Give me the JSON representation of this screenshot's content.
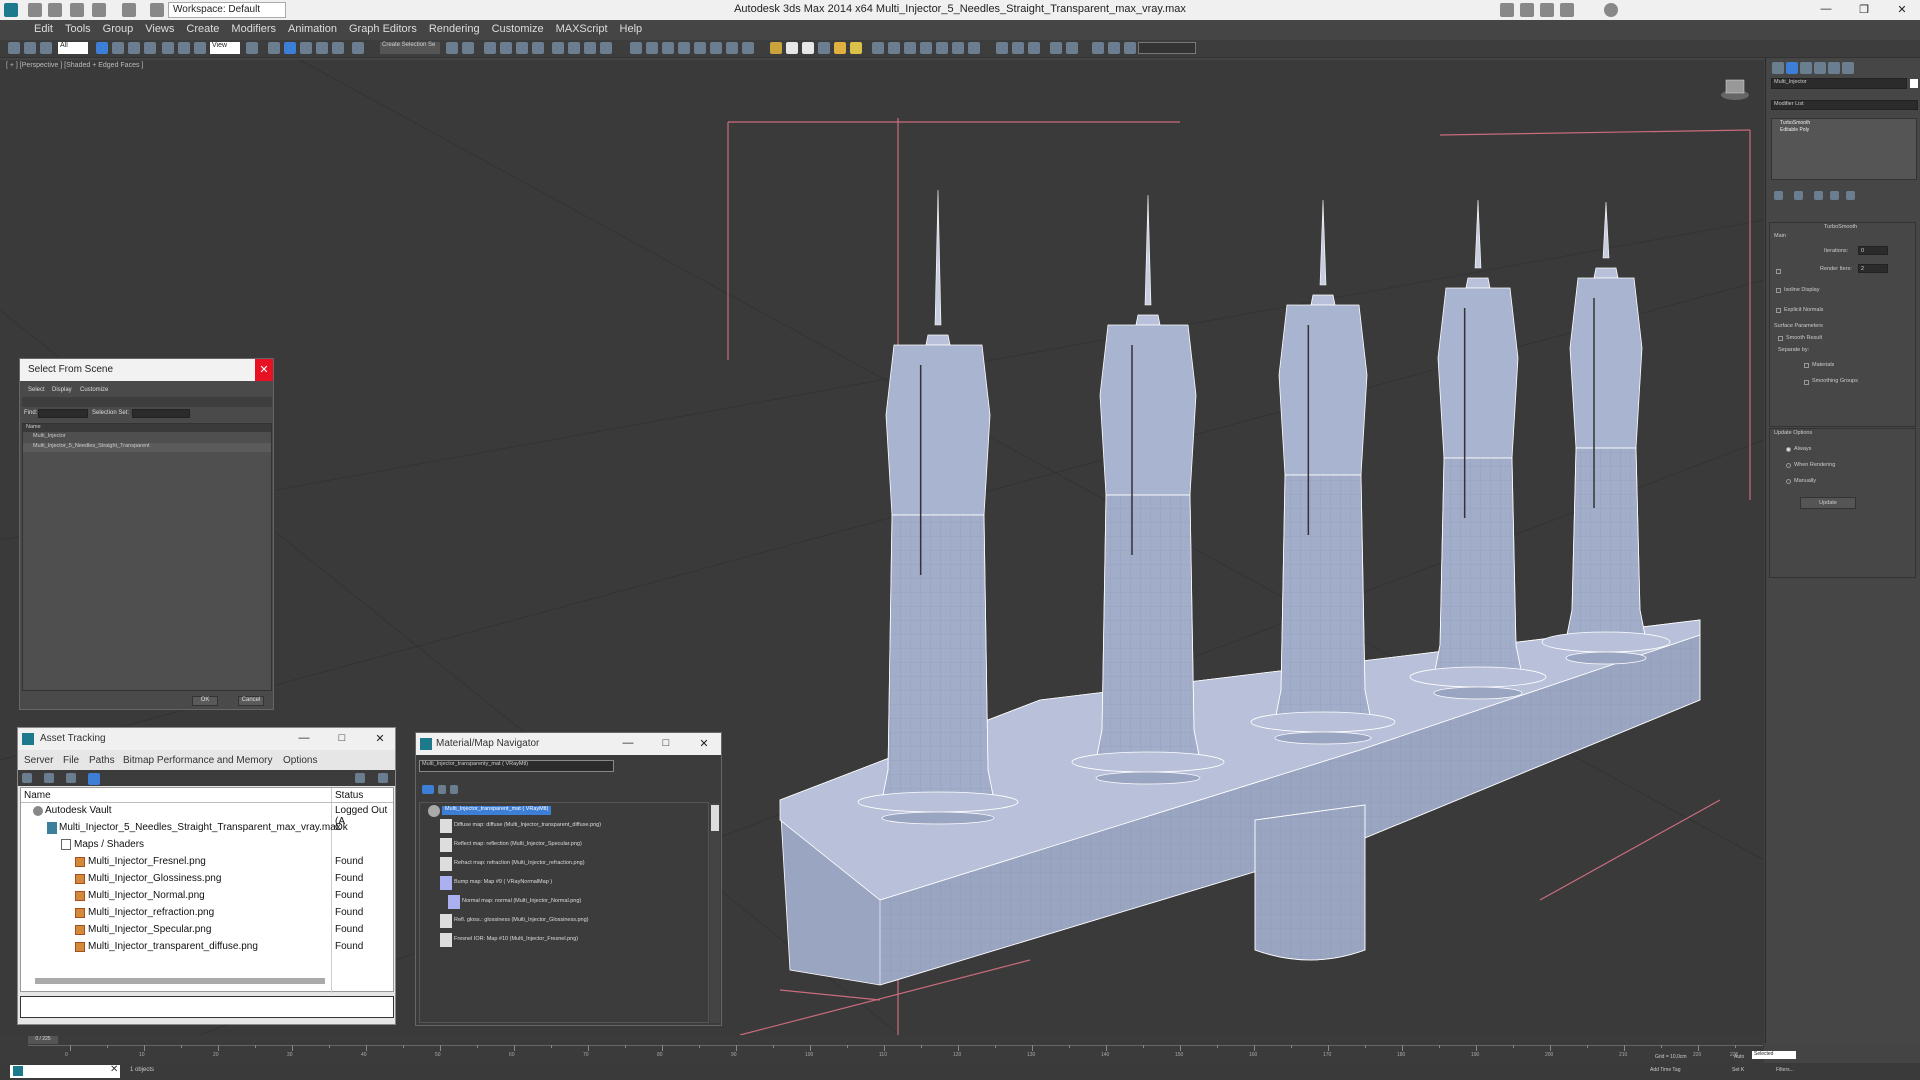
{
  "window": {
    "title": "Autodesk 3ds Max  2014 x64     Multi_Injector_5_Needles_Straight_Transparent_max_vray.max",
    "workspace": "Workspace: Default"
  },
  "menu": [
    "Edit",
    "Tools",
    "Group",
    "Views",
    "Create",
    "Modifiers",
    "Animation",
    "Graph Editors",
    "Rendering",
    "Customize",
    "MAXScript",
    "Help"
  ],
  "toolbar": {
    "selection_filter": "All",
    "ref_coord": "View",
    "named_sel": "Create Selection Se"
  },
  "viewport": {
    "label": "[ + ] [Perspective ] [Shaded + Edged Faces ]"
  },
  "command_panel": {
    "object_name": "Multi_Injector",
    "modifier_list": "Modifier List",
    "stack": [
      "TurboSmooth",
      "Editable Poly"
    ],
    "rollout_title": "TurboSmooth",
    "main_label": "Main",
    "iterations_label": "Iterations:",
    "iterations_value": "0",
    "render_iters_label": "Render Iters:",
    "render_iters_value": "2",
    "isoline": "Isoline Display",
    "explicit_normals": "Explicit Normals",
    "surface_params": "Surface Parameters",
    "smooth_result": "Smooth Result",
    "separate_by": "Separate by:",
    "materials": "Materials",
    "smoothing_groups": "Smoothing Groups",
    "update_options": "Update Options",
    "always": "Always",
    "when_rendering": "When Rendering",
    "manually": "Manually",
    "update_btn": "Update"
  },
  "select_from_scene": {
    "title": "Select From Scene",
    "menu": [
      "Select",
      "Display",
      "Customize"
    ],
    "find_label": "Find:",
    "selection_set_label": "Selection Set:",
    "column": "Name",
    "items": [
      "Multi_Injector",
      "Multi_Injector_5_Needles_Straight_Transparent"
    ],
    "ok": "OK",
    "cancel": "Cancel"
  },
  "asset_tracking": {
    "title": "Asset Tracking",
    "menu": [
      "Server",
      "File",
      "Paths",
      "Bitmap Performance and Memory",
      "Options"
    ],
    "col_name": "Name",
    "col_status": "Status",
    "rows": [
      {
        "name": "Autodesk Vault",
        "status": "Logged Out (A"
      },
      {
        "name": "Multi_Injector_5_Needles_Straight_Transparent_max_vray.max",
        "status": "Ok"
      },
      {
        "name": "Maps / Shaders",
        "status": ""
      },
      {
        "name": "Multi_Injector_Fresnel.png",
        "status": "Found"
      },
      {
        "name": "Multi_Injector_Glossiness.png",
        "status": "Found"
      },
      {
        "name": "Multi_Injector_Normal.png",
        "status": "Found"
      },
      {
        "name": "Multi_Injector_refraction.png",
        "status": "Found"
      },
      {
        "name": "Multi_Injector_Specular.png",
        "status": "Found"
      },
      {
        "name": "Multi_Injector_transparent_diffuse.png",
        "status": "Found"
      }
    ]
  },
  "material_navigator": {
    "title": "Material/Map Navigator",
    "field": "Multi_Injector_transparenty_mat  ( VRayMtl)",
    "root": "Multi_Injector_transparent_mat  ( VRayMtl)",
    "items": [
      "Diffuse map: diffuse (Multi_Injector_transparent_diffuse.png)",
      "Reflect map: reflection (Multi_Injector_Specular.png)",
      "Refract map: refraction (Multi_Injector_refraction.png)",
      "Bump map: Map #9  ( VRayNormalMap )",
      "Normal map: normal (Multi_Injector_Normal.png)",
      "Refl. gloss.: glossiness (Multi_Injector_Glossiness.png)",
      "Fresnel IOR: Map #10 (Multi_Injector_Fresnel.png)"
    ]
  },
  "timeline": {
    "frame": "0 / 225",
    "ticks": [
      "0",
      "10",
      "20",
      "30",
      "40",
      "50",
      "60",
      "70",
      "80",
      "90",
      "100",
      "110",
      "120",
      "130",
      "140",
      "150",
      "160",
      "170",
      "180",
      "190",
      "200",
      "210",
      "220",
      "225"
    ]
  },
  "status": {
    "left": "1 objects",
    "selected": "Selected",
    "auto": "Auto",
    "set_key": "Set K",
    "grid": "Grid = 10,0cm",
    "add_time_tag": "Add Time Tag",
    "filters": "Filters..."
  },
  "colors": {
    "accent": "#1e90ff",
    "mesh": "#a9b4d0",
    "bbox": "#d06a7a"
  }
}
